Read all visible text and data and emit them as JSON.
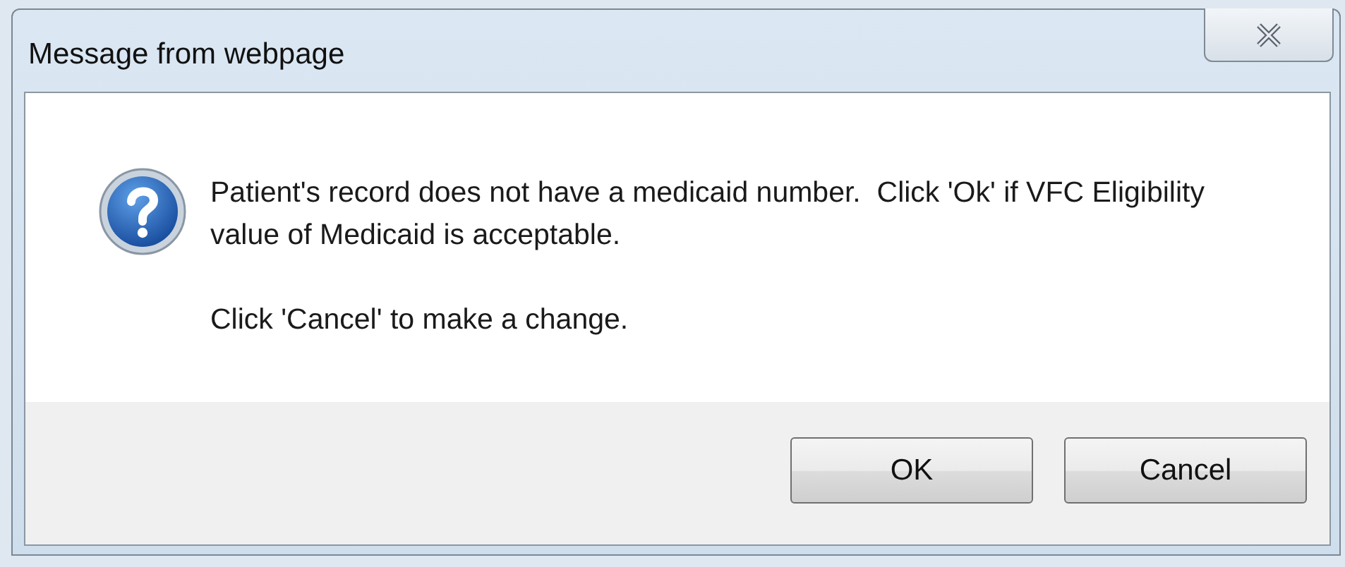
{
  "window": {
    "title": "Message from webpage"
  },
  "message": {
    "paragraphs": [
      "Patient's record does not have a medicaid number.  Click 'Ok' if VFC Eligibility value of Medicaid is acceptable.",
      "Click 'Cancel' to make a change."
    ]
  },
  "buttons": [
    "OK",
    "Cancel"
  ]
}
